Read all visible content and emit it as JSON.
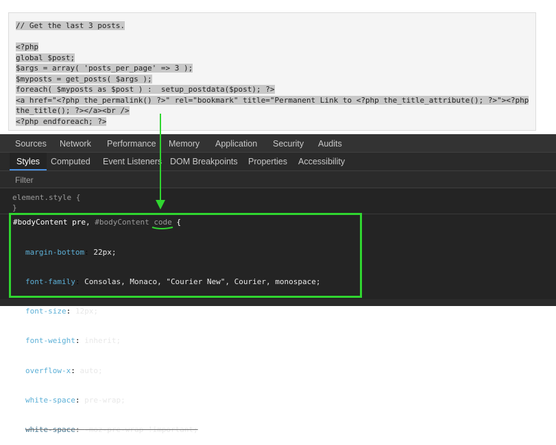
{
  "code_block": {
    "lines": [
      "// Get the last 3 posts.",
      "",
      "<?php",
      "global $post;",
      "$args = array( 'posts_per_page' => 3 );",
      "$myposts = get_posts( $args );",
      "foreach( $myposts as $post ) :  setup_postdata($post); ?>",
      "<a href=\"<?php the_permalink() ?>\" rel=\"bookmark\" title=\"Permanent Link to <?php the_title_attribute(); ?>\"><?php",
      "the_title(); ?></a><br />",
      "<?php endforeach; ?>"
    ]
  },
  "devtools": {
    "main_tabs": [
      "Sources",
      "Network",
      "Performance",
      "Memory",
      "Application",
      "Security",
      "Audits"
    ],
    "sub_tabs": [
      "Styles",
      "Computed",
      "Event Listeners",
      "DOM Breakpoints",
      "Properties",
      "Accessibility"
    ],
    "active_sub_tab": "Styles",
    "filter_placeholder": "Filter",
    "element_style": {
      "open": "element.style {",
      "close": "}"
    },
    "rule": {
      "selector_main": "#bodyContent pre,",
      "selector_dim": " #bodyContent ",
      "selector_code": "code",
      "selector_brace": " {",
      "properties": [
        {
          "name": "margin-bottom",
          "value": "22px;"
        },
        {
          "name": "font-family",
          "value": "Consolas, Monaco, \"Courier New\", Courier, monospace;"
        },
        {
          "name": "font-size",
          "value": "12px;"
        },
        {
          "name": "font-weight",
          "value": "inherit;"
        },
        {
          "name": "overflow-x",
          "value": "auto;"
        },
        {
          "name": "white-space",
          "value": "pre-wrap;"
        },
        {
          "name": "white-space",
          "value": "-moz-pre-wrap !important;",
          "struck": true
        }
      ]
    }
  },
  "annotation": {
    "highlight_color": "#30d630"
  }
}
